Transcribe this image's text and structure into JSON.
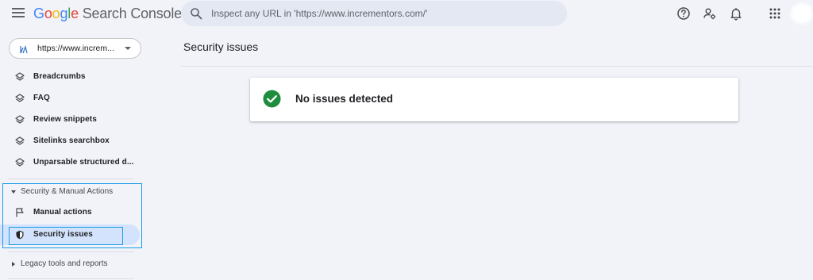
{
  "header": {
    "logo_google": [
      "G",
      "o",
      "o",
      "g",
      "l",
      "e"
    ],
    "logo_product": "Search Console",
    "search_placeholder": "Inspect any URL in 'https://www.incrementors.com/'",
    "icons": [
      "help-icon",
      "account-settings-icon",
      "notifications-icon",
      "apps-grid-icon"
    ]
  },
  "sidebar": {
    "property": "https://www.increm...",
    "items": [
      {
        "label": "Breadcrumbs",
        "icon": "layers-icon"
      },
      {
        "label": "FAQ",
        "icon": "layers-icon"
      },
      {
        "label": "Review snippets",
        "icon": "layers-icon"
      },
      {
        "label": "Sitelinks searchbox",
        "icon": "layers-icon"
      },
      {
        "label": "Unparsable structured d...",
        "icon": "layers-icon"
      }
    ],
    "security_section": {
      "label": "Security & Manual Actions",
      "items": [
        {
          "label": "Manual actions",
          "icon": "flag-icon"
        },
        {
          "label": "Security issues",
          "icon": "shield-icon",
          "active": true
        }
      ]
    },
    "legacy_section": {
      "label": "Legacy tools and reports"
    }
  },
  "main": {
    "title": "Security issues",
    "status_text": "No issues detected"
  },
  "colors": {
    "accent_blue": "#1a9be6",
    "success_green": "#1e8e3e",
    "active_bg": "#d3e3fd",
    "page_bg": "#f1f3f9"
  }
}
